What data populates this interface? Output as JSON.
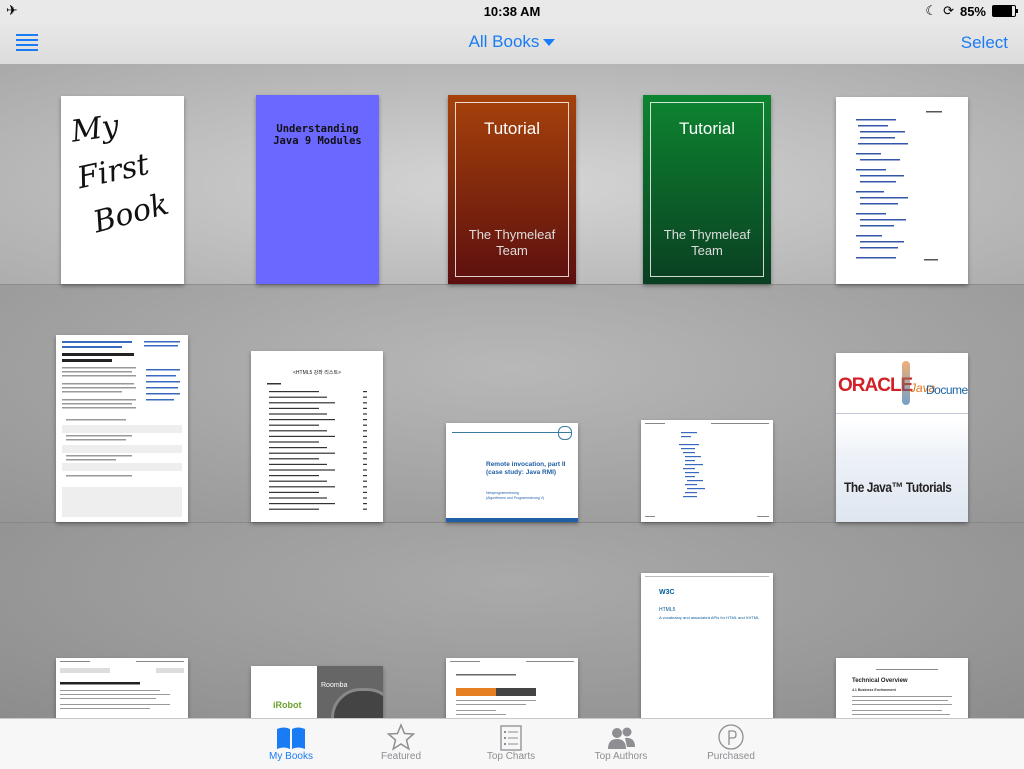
{
  "status": {
    "time": "10:38 AM",
    "battery": "85%"
  },
  "nav": {
    "title": "All Books",
    "select_label": "Select"
  },
  "books": {
    "b1": {
      "lines": [
        "My",
        "First",
        "Book"
      ]
    },
    "b2": {
      "title_line1": "Understanding",
      "title_line2": "Java 9 Modules"
    },
    "b3": {
      "title": "Tutorial",
      "author_line1": "The Thymeleaf",
      "author_line2": "Team"
    },
    "b4": {
      "title": "Tutorial",
      "author_line1": "The Thymeleaf",
      "author_line2": "Team"
    },
    "b7": {
      "heading": "<HTML5 강좌 리스트>"
    },
    "b8": {
      "title_line1": "Remote invocation, part II",
      "title_line2": "(case study: Java RMI)",
      "sub_line1": "Netzprogrammierung",
      "sub_line2": "(Algorithmen und Programmierung V)"
    },
    "b10": {
      "oracle": "ORACLE",
      "java": "Java",
      "documentation": "Documentation",
      "tutorials": "The Java™ Tutorials"
    },
    "b11": {
      "logo": "W3C",
      "line1": "HTML5",
      "line2": "A vocabulary and associated APIs for HTML and XHTML"
    },
    "b13": {
      "brand": "iRobot",
      "product": "Roomba"
    },
    "b15": {
      "title": "Technical Overview",
      "subtitle": "4.1 Business Environment"
    }
  },
  "tabs": [
    {
      "label": "My Books",
      "icon": "book-open-icon"
    },
    {
      "label": "Featured",
      "icon": "star-icon"
    },
    {
      "label": "Top Charts",
      "icon": "list-icon"
    },
    {
      "label": "Top Authors",
      "icon": "people-icon"
    },
    {
      "label": "Purchased",
      "icon": "purchased-icon"
    }
  ],
  "colors": {
    "accent": "#1a7cf5",
    "b2": "#6b68ff",
    "b3": "#a6420b",
    "b4": "#0d7a2d"
  }
}
